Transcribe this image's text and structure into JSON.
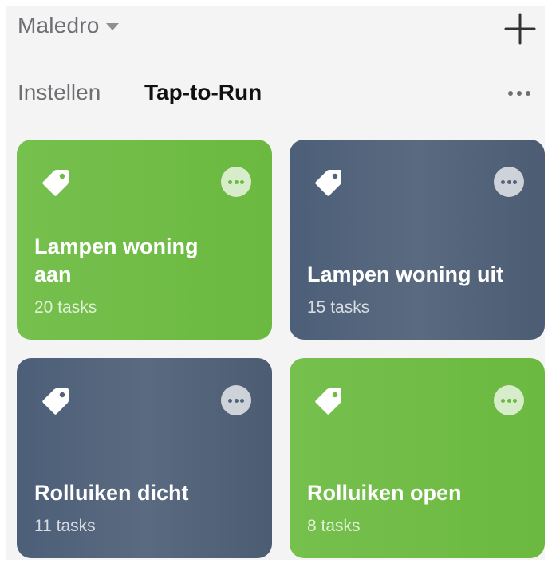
{
  "header": {
    "home_name": "Maledro"
  },
  "tabs": [
    {
      "label": "Instellen"
    },
    {
      "label": "Tap-to-Run"
    }
  ],
  "scenes": [
    {
      "title": "Lampen woning aan",
      "count": "20 tasks",
      "color": "#6bb940"
    },
    {
      "title": "Lampen woning uit",
      "count": "15 tasks",
      "color": "#52637a"
    },
    {
      "title": "Rolluiken dicht",
      "count": "11 tasks",
      "color": "#52637a"
    },
    {
      "title": "Rolluiken open",
      "count": "8 tasks",
      "color": "#6bb940"
    }
  ],
  "icons": {
    "add": "plus-icon",
    "caret": "chevron-down-icon",
    "more": "more-horizontal-icon",
    "scene": "tag-icon"
  }
}
